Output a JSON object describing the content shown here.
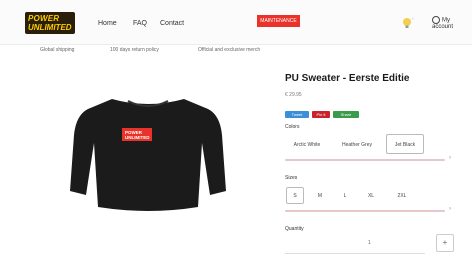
{
  "header": {
    "logo_line1": "POWER",
    "logo_line2": "UNLIMITED",
    "nav": [
      "Home",
      "FAQ",
      "Contact"
    ],
    "maintenance_label": "MAINTENANCE",
    "account_label": "My account"
  },
  "usp": [
    "Global shipping",
    "100 days return policy",
    "Official and exclusive merch"
  ],
  "product": {
    "title": "PU Sweater - Eerste Editie",
    "price": "€ 29.95",
    "print_line1": "POWER",
    "print_line2": "UNLIMITED",
    "share": [
      {
        "label": "Tweet",
        "color": "#3a8fd6"
      },
      {
        "label": "Pin it",
        "color": "#c8232c"
      },
      {
        "label": "Share",
        "color": "#3b9b4c"
      }
    ],
    "colors_label": "Colors",
    "colors": [
      "Arctic White",
      "Heather Grey",
      "Jet Black"
    ],
    "selected_color": "Jet Black",
    "sizes_label": "Sizes",
    "sizes": [
      "S",
      "M",
      "L",
      "XL",
      "2XL"
    ],
    "selected_size": "S",
    "quantity_label": "Quantity",
    "quantity_value": "1",
    "quantity_plus": "+"
  },
  "colors": {
    "accent_red": "#e8322a",
    "sweater": "#1b1b1b",
    "logo_bg": "#2a1f0a",
    "logo_text": "#ffcc00"
  },
  "icons": [
    "bulb-icon",
    "user-icon",
    "arrow-right-icon"
  ]
}
